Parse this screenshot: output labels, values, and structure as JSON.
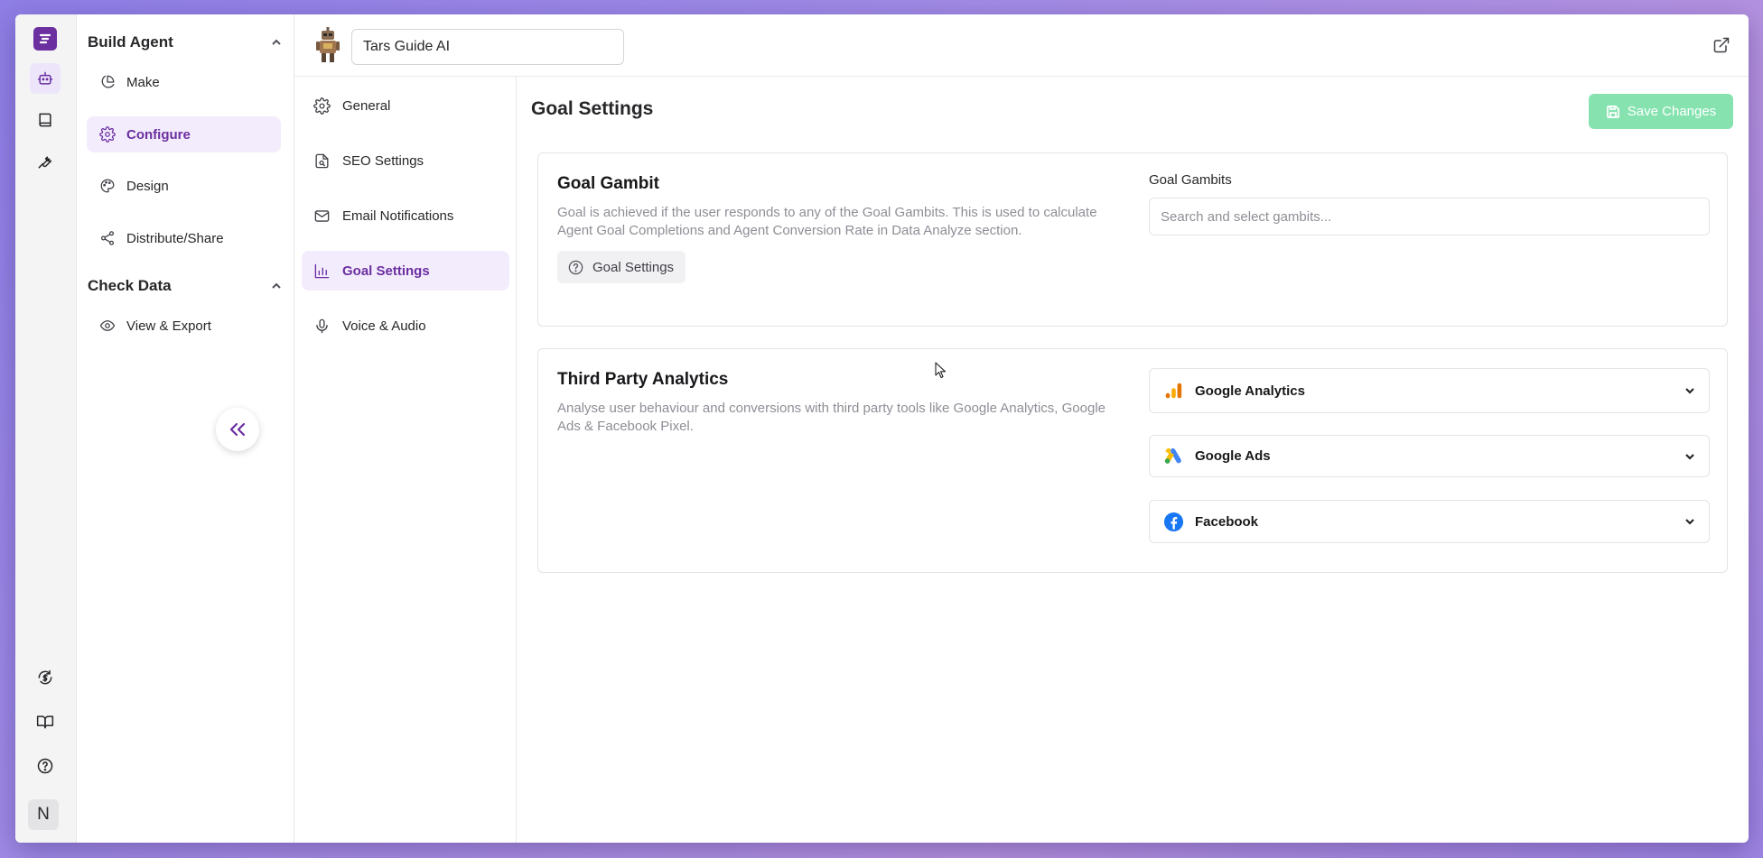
{
  "app": {
    "agent_name": "Tars Guide AI",
    "rail_avatar_letter": "N",
    "accent_color": "#6b2fa0",
    "save_color": "#86e3b0"
  },
  "rail": {
    "icons": [
      "logo-icon",
      "bot-icon",
      "book-icon",
      "wrench-icon",
      "billing-icon",
      "docs-book-icon",
      "help-icon"
    ]
  },
  "build_sidebar": {
    "section_build": "Build Agent",
    "items": [
      {
        "label": "Make",
        "icon": "pie-chart-icon"
      },
      {
        "label": "Configure",
        "icon": "gear-icon"
      },
      {
        "label": "Design",
        "icon": "palette-icon"
      },
      {
        "label": "Distribute/Share",
        "icon": "share-icon"
      }
    ],
    "section_check": "Check Data",
    "check_items": [
      {
        "label": "View & Export",
        "icon": "eye-icon"
      }
    ]
  },
  "settings_menu": {
    "items": [
      {
        "label": "General",
        "icon": "gear-icon"
      },
      {
        "label": "SEO Settings",
        "icon": "file-search-icon"
      },
      {
        "label": "Email Notifications",
        "icon": "mail-icon"
      },
      {
        "label": "Goal Settings",
        "icon": "bar-chart-icon"
      },
      {
        "label": "Voice & Audio",
        "icon": "mic-icon"
      }
    ]
  },
  "main": {
    "title": "Goal Settings",
    "save_label": "Save Changes",
    "goal_gambit": {
      "title": "Goal Gambit",
      "description": "Goal is achieved if the user responds to any of the Goal Gambits. This is used to calculate Agent Goal Completions and Agent Conversion Rate in Data Analyze section.",
      "help_label": "Goal Settings",
      "field_label": "Goal Gambits",
      "placeholder": "Search and select gambits..."
    },
    "third_party": {
      "title": "Third Party Analytics",
      "description": "Analyse user behaviour and conversions with third party tools like Google Analytics, Google Ads & Facebook Pixel.",
      "integrations": [
        {
          "label": "Google Analytics",
          "icon": "google-analytics-icon"
        },
        {
          "label": "Google Ads",
          "icon": "google-ads-icon"
        },
        {
          "label": "Facebook",
          "icon": "facebook-icon"
        }
      ]
    }
  }
}
